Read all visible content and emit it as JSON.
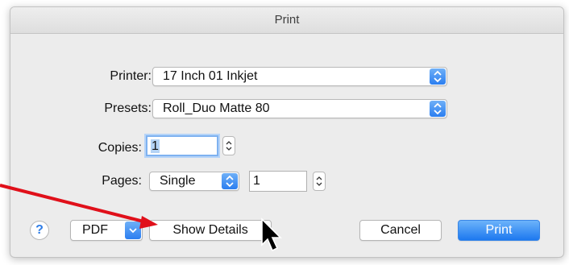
{
  "dialog": {
    "title": "Print"
  },
  "printer": {
    "label": "Printer:",
    "value": "17 Inch 01 Inkjet"
  },
  "presets": {
    "label": "Presets:",
    "value": "Roll_Duo Matte 80"
  },
  "copies": {
    "label": "Copies:",
    "value": "1"
  },
  "pages": {
    "label": "Pages:",
    "mode": "Single",
    "value": "1"
  },
  "footer": {
    "help_label": "?",
    "pdf_label": "PDF",
    "show_details_label": "Show Details",
    "cancel_label": "Cancel",
    "print_label": "Print"
  },
  "colors": {
    "accent": "#2b7ef0",
    "annotation_arrow": "#e0101a"
  }
}
